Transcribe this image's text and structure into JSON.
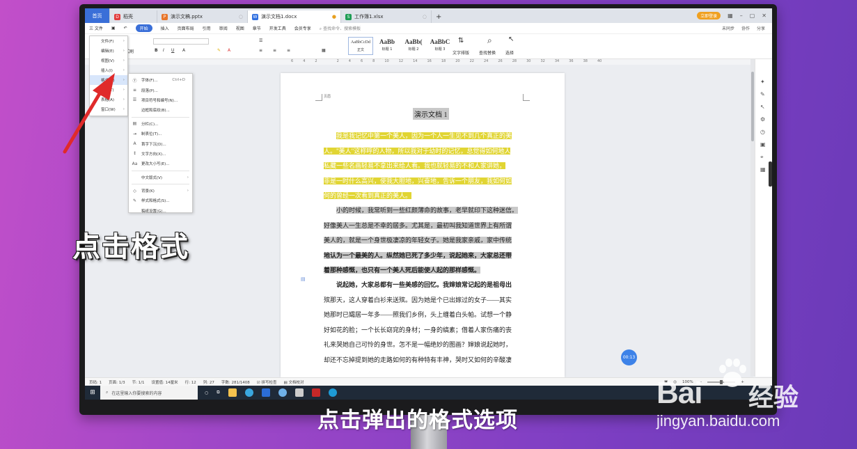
{
  "tabs": [
    {
      "label": "首页"
    },
    {
      "label": "稻壳"
    },
    {
      "label": "演示文稿.pptx"
    },
    {
      "label": "演示文档1.docx"
    },
    {
      "label": "工作簿1.xlsx"
    }
  ],
  "login_label": "立即登录",
  "menubar": {
    "file": "三 文件",
    "items": [
      "开始",
      "插入",
      "页面布局",
      "引用",
      "审阅",
      "视图",
      "章节",
      "开发工具",
      "会员专享"
    ],
    "search": "查找命令、搜索模板",
    "right": [
      "未同步",
      "协作",
      "分享"
    ]
  },
  "ribbon": {
    "format_painter": "格式刷",
    "styles": [
      {
        "sample": "AaBbCcDd",
        "name": "正文"
      },
      {
        "sample": "AaBb",
        "name": "标题 1"
      },
      {
        "sample": "AaBb(",
        "name": "标题 2"
      },
      {
        "sample": "AaBbC",
        "name": "标题 3"
      }
    ],
    "text_layout": "文字排版",
    "find_replace": "查找替换",
    "select": "选择"
  },
  "ruler_marks": [
    "6",
    "4",
    "2",
    "",
    "2",
    "4",
    "6",
    "8",
    "10",
    "12",
    "14",
    "16",
    "18",
    "20",
    "22",
    "24",
    "26",
    "28",
    "30",
    "32",
    "34",
    "36",
    "38",
    "40"
  ],
  "menu1": [
    "文件(F)",
    "编辑(E)",
    "视图(V)",
    "插入(I)",
    "格式(O)",
    "工具(T)",
    "表格(A)",
    "窗口(W)"
  ],
  "menu2": [
    {
      "icon": "font-icon",
      "glyph": "Ⓣ",
      "label": "字体(F)...",
      "shortcut": "Ctrl+D"
    },
    {
      "icon": "paragraph-icon",
      "glyph": "≡",
      "label": "段落(P)..."
    },
    {
      "icon": "list-icon",
      "glyph": "☰",
      "label": "项目符号和编号(N)..."
    },
    {
      "icon": "",
      "glyph": "",
      "label": "边框和底纹(B)..."
    },
    {
      "sep": true
    },
    {
      "icon": "columns-icon",
      "glyph": "▤",
      "label": "分栏(C)..."
    },
    {
      "icon": "tab-stop-icon",
      "glyph": "⇥",
      "label": "制表位(T)..."
    },
    {
      "icon": "drop-cap-icon",
      "glyph": "A",
      "label": "首字下沉(D)..."
    },
    {
      "icon": "text-direction-icon",
      "glyph": "↕",
      "label": "文字方向(X)..."
    },
    {
      "icon": "change-case-icon",
      "glyph": "Aa",
      "label": "更改大小写(E)..."
    },
    {
      "sep": true
    },
    {
      "icon": "",
      "glyph": "",
      "label": "中文版式(V)",
      "arrow": true
    },
    {
      "sep": true
    },
    {
      "icon": "background-icon",
      "glyph": "◇",
      "label": "背景(K)",
      "arrow": true
    },
    {
      "icon": "styles-icon",
      "glyph": "✎",
      "label": "样式和格式(S)..."
    },
    {
      "icon": "",
      "glyph": "",
      "label": "稿纸设置(G)..."
    }
  ],
  "document": {
    "page_header": "页眉",
    "title": "演示文档 1",
    "para1": [
      "我是我记忆中第一个美人，因为一个人一生见不到几个真正的美",
      "人。\"美人\"这称呼的人物，所以我对于幼时的记忆，总觉得如何地人",
      "私藏一些名画轻易不拿出来给人看。我也就轻易的不和人家讲她，",
      "非是一时什么高兴，使我大胆地，兴奋地，告诉一个朋友，我如何如",
      "何的曾经一次看到真正的美人。"
    ],
    "para2": [
      "小的时候，我常听到一些红颜薄命的故事，老早就印下这种迷信。",
      "好像美人一生总是不幸的居多。尤其是，最初叫我知道世界上有所谓",
      "美人的，就是一个身世极凄凉的年轻女子。她是我家亲戚，家中传统",
      "地认为一个最美的人。纵然她已死了多少年，说起她来，大家总还带",
      "着那种感慨，也只有一个美人死后能使人起的那样感慨。"
    ],
    "para3": [
      "说起她，大家总都有一些美感的回忆。我婶娘常记起的是祖母出",
      "殡那天，这人穿着白衫来送殡。因为她是个已出嫁过的女子——其实",
      "她那时已孀居一年多——照我们乡例，头上缠着白头帕。试想一个静",
      "好如花的脸；一个长长窈窕的身材；一身的缟素；借着人家伤痛的丧",
      "礼来哭她自己可怜的身世。怎不是一幅绝妙的图画？婶娘说起她时，",
      "却还不忘掉提到她的走路如何的有种特有丰神，哭时又如何的辛酸凄"
    ]
  },
  "timer": "00:13",
  "status": {
    "page": "页码: 1",
    "pages": "页面: 1/3",
    "section": "节: 1/1",
    "setting": "设置值: 14厘米",
    "row": "行: 12",
    "col": "列: 27",
    "words": "字数: 281/1408",
    "spell": "拼写检查",
    "proof": "文档校对",
    "zoom": "100%"
  },
  "taskbar": {
    "search": "在这里输入你要搜索的内容"
  },
  "caption_left": "点击格式",
  "subtitle": "点击弹出的格式选项",
  "watermark": {
    "baidu": "Bai",
    "du": "du",
    "jingyan": "经验",
    "url": "jingyan.baidu.com"
  },
  "colors": {
    "accent": "#3a6fd8",
    "highlight": "#e1d533",
    "arrow": "#e02a2a"
  }
}
